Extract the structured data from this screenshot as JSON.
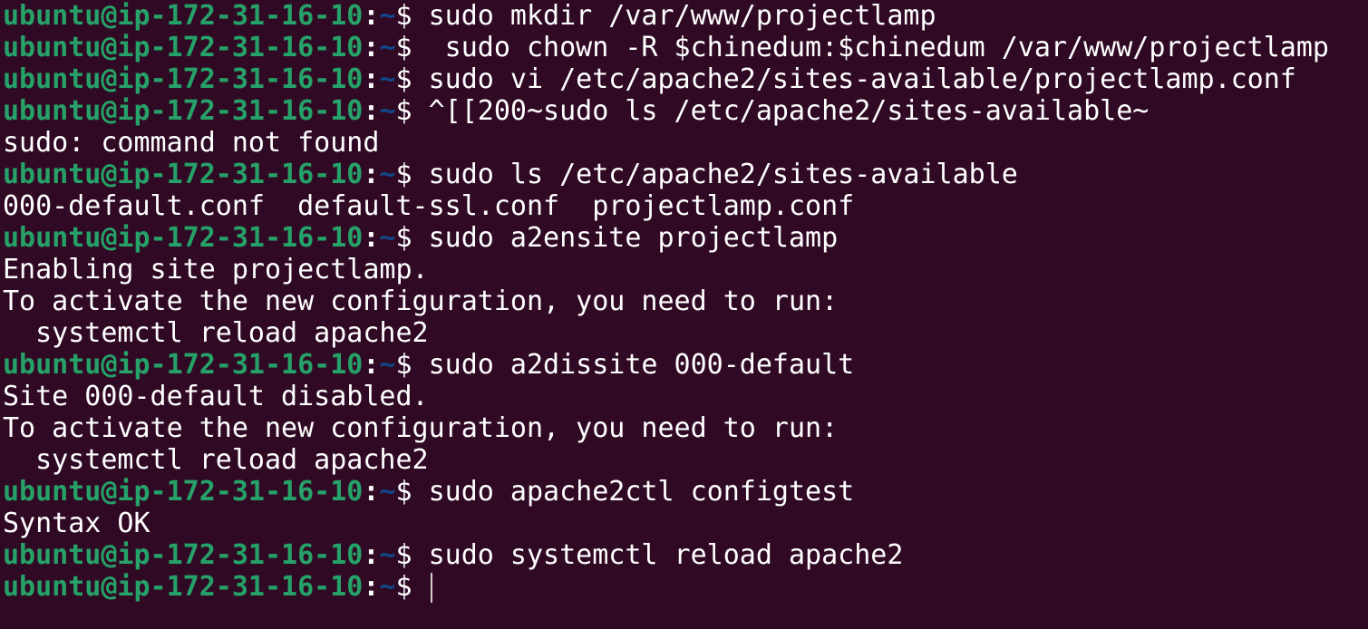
{
  "terminal": {
    "prompt": {
      "user_host": "ubuntu@ip-172-31-16-10",
      "colon": ":",
      "cwd": "~",
      "dollar": "$"
    },
    "lines": [
      {
        "type": "prompt",
        "command": " sudo mkdir /var/www/projectlamp"
      },
      {
        "type": "prompt",
        "command": "  sudo chown -R $chinedum:$chinedum /var/www/projectlamp"
      },
      {
        "type": "prompt",
        "command": " sudo vi /etc/apache2/sites-available/projectlamp.conf"
      },
      {
        "type": "prompt",
        "command": " ^[[200~sudo ls /etc/apache2/sites-available~"
      },
      {
        "type": "output",
        "text": "sudo: command not found"
      },
      {
        "type": "prompt",
        "command": " sudo ls /etc/apache2/sites-available"
      },
      {
        "type": "output",
        "text": "000-default.conf  default-ssl.conf  projectlamp.conf"
      },
      {
        "type": "prompt",
        "command": " sudo a2ensite projectlamp"
      },
      {
        "type": "output",
        "text": "Enabling site projectlamp."
      },
      {
        "type": "output",
        "text": "To activate the new configuration, you need to run:"
      },
      {
        "type": "output",
        "text": "  systemctl reload apache2"
      },
      {
        "type": "prompt",
        "command": " sudo a2dissite 000-default"
      },
      {
        "type": "output",
        "text": "Site 000-default disabled."
      },
      {
        "type": "output",
        "text": "To activate the new configuration, you need to run:"
      },
      {
        "type": "output",
        "text": "  systemctl reload apache2"
      },
      {
        "type": "prompt",
        "command": " sudo apache2ctl configtest"
      },
      {
        "type": "output",
        "text": "Syntax OK"
      },
      {
        "type": "prompt",
        "command": " sudo systemctl reload apache2"
      },
      {
        "type": "prompt",
        "command": " ",
        "cursor": true
      }
    ],
    "colors": {
      "background": "#300a24",
      "user_host": "#26a269",
      "cwd": "#12488b",
      "text": "#ffffff",
      "cursor": "#d0cfcc"
    }
  }
}
